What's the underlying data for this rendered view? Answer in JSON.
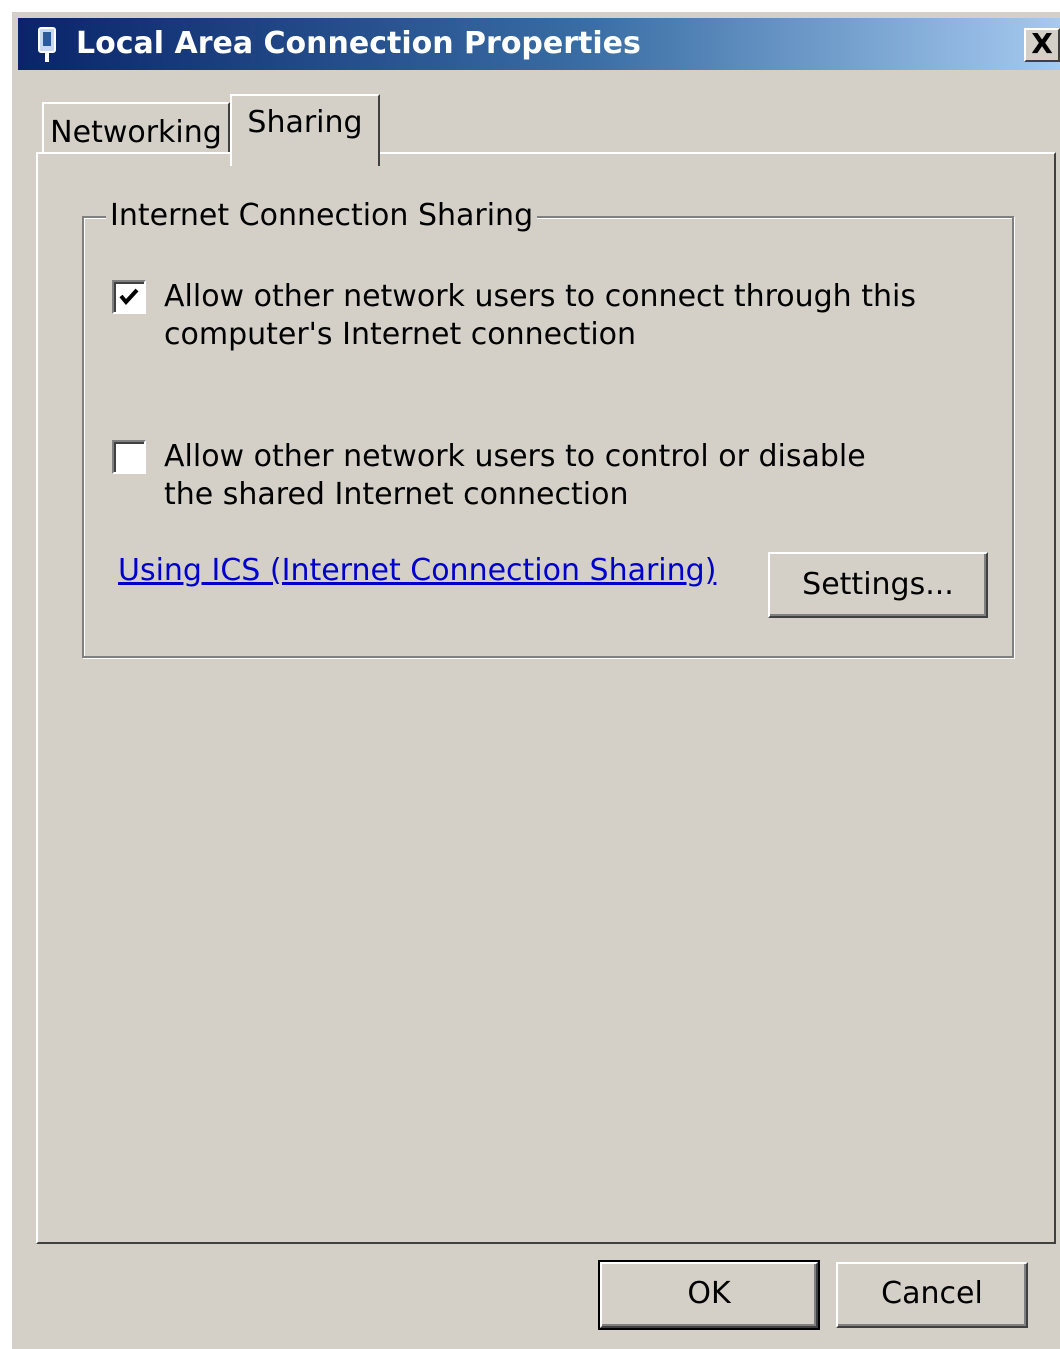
{
  "window": {
    "title": "Local Area Connection Properties",
    "title_icon": "network-adapter-icon",
    "close_label": "X"
  },
  "tabs": [
    {
      "label": "Networking",
      "selected": false
    },
    {
      "label": "Sharing",
      "selected": true
    }
  ],
  "sharing": {
    "group_title": "Internet Connection Sharing",
    "options": [
      {
        "label": "Allow other network users to connect through this computer's Internet connection",
        "checked": true
      },
      {
        "label": "Allow other network users to control or disable the shared Internet connection",
        "checked": false
      }
    ],
    "help_link": "Using ICS (Internet Connection Sharing)",
    "settings_button": "Settings..."
  },
  "footer": {
    "ok_label": "OK",
    "cancel_label": "Cancel"
  },
  "colors": {
    "dialog_background": "#d4d0c8",
    "titlebar_start": "#0a246a",
    "titlebar_end": "#a6caf0",
    "link": "#0000cc"
  }
}
